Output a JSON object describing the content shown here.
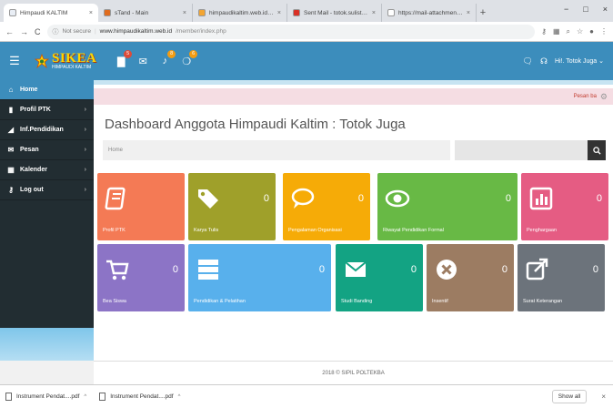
{
  "browser": {
    "tabs": [
      {
        "title": "Himpaudi KALTIM",
        "active": true,
        "color": "#e9eef5"
      },
      {
        "title": "sTand - Main",
        "active": false,
        "color": "#e06c1e"
      },
      {
        "title": "himpaudikaltim.web.id / local /",
        "active": false,
        "color": "#f3a532"
      },
      {
        "title": "Sent Mail - totok.sulistyo@gm",
        "active": false,
        "color": "#d93025"
      },
      {
        "title": "https://mail-attachment.googl",
        "active": false,
        "color": "#ffffff"
      }
    ],
    "tab_close": "×",
    "new_tab": "+",
    "window_controls": {
      "minimize": "−",
      "maximize": "□",
      "close": "×"
    },
    "back": "←",
    "forward": "→",
    "reload": "C",
    "secure_label": "Not secure",
    "url_host": "www.himpaudikaltim.web.id",
    "url_path": "/member/index.php"
  },
  "header": {
    "brand_main": "SIKEA",
    "brand_sub": "HIMPAUDI KALTIM",
    "badges": [
      {
        "icon": "clipboard-icon",
        "count": "5",
        "color": "#dd4b39"
      },
      {
        "icon": "envelope-icon",
        "count": "",
        "color": ""
      },
      {
        "icon": "bell-icon",
        "count": "8",
        "color": "#f39c12"
      },
      {
        "icon": "chat-icon",
        "count": "6",
        "color": "#f39c12"
      }
    ],
    "user_name": "Hi!. Totok Juga",
    "user_caret": "⌄"
  },
  "sidebar": {
    "items": [
      {
        "label": "Home",
        "icon": "home-icon",
        "active": true
      },
      {
        "label": "Profil PTK",
        "icon": "book-icon",
        "active": false
      },
      {
        "label": "Inf.Pendidikan",
        "icon": "chart-icon",
        "active": false
      },
      {
        "label": "Pesan",
        "icon": "envelope-icon",
        "active": false
      },
      {
        "label": "Kalender",
        "icon": "calendar-icon",
        "active": false
      },
      {
        "label": "Log out",
        "icon": "key-icon",
        "active": false
      }
    ],
    "chevron": "›"
  },
  "main": {
    "alert_text": "Pesan ba",
    "page_title": "Dashboard Anggota Himpaudi Kaltim : Totok Juga",
    "breadcrumb": "Home",
    "search_placeholder": "",
    "cards_row1": [
      {
        "label": "Profil PTK",
        "count": "",
        "color": "#f47a55",
        "icon": "book"
      },
      {
        "label": "Karya Tulis",
        "count": "0",
        "color": "#9fa02a",
        "icon": "tag"
      },
      {
        "label": "Pengalaman Organisasi",
        "count": "0",
        "color": "#f6ab07",
        "icon": "chat"
      },
      {
        "label": "Riwayat Pendidikan Formal",
        "count": "0",
        "color": "#68b945",
        "icon": "eye"
      },
      {
        "label": "Penghargaan",
        "count": "0",
        "color": "#e55c83",
        "icon": "chart"
      }
    ],
    "cards_row2": [
      {
        "label": "Bea Siswa",
        "count": "0",
        "color": "#8c74c6",
        "icon": "cart"
      },
      {
        "label": "Pendidikan & Pelatihan",
        "count": "0",
        "color": "#58b0ec",
        "icon": "server"
      },
      {
        "label": "Studi Banding",
        "count": "0",
        "color": "#13a383",
        "icon": "mail"
      },
      {
        "label": "Insentif",
        "count": "0",
        "color": "#9c7c62",
        "icon": "xcircle"
      },
      {
        "label": "Surat Keterangan",
        "count": "0",
        "color": "#6c737b",
        "icon": "share"
      }
    ]
  },
  "footer": {
    "text": "2018 © SIPIL POLTEKBA"
  },
  "downloads": {
    "items": [
      "Instrument Pendat....pdf",
      "Instrument Pendat....pdf"
    ],
    "item_caret": "^",
    "show_all": "Show all",
    "close": "×"
  }
}
